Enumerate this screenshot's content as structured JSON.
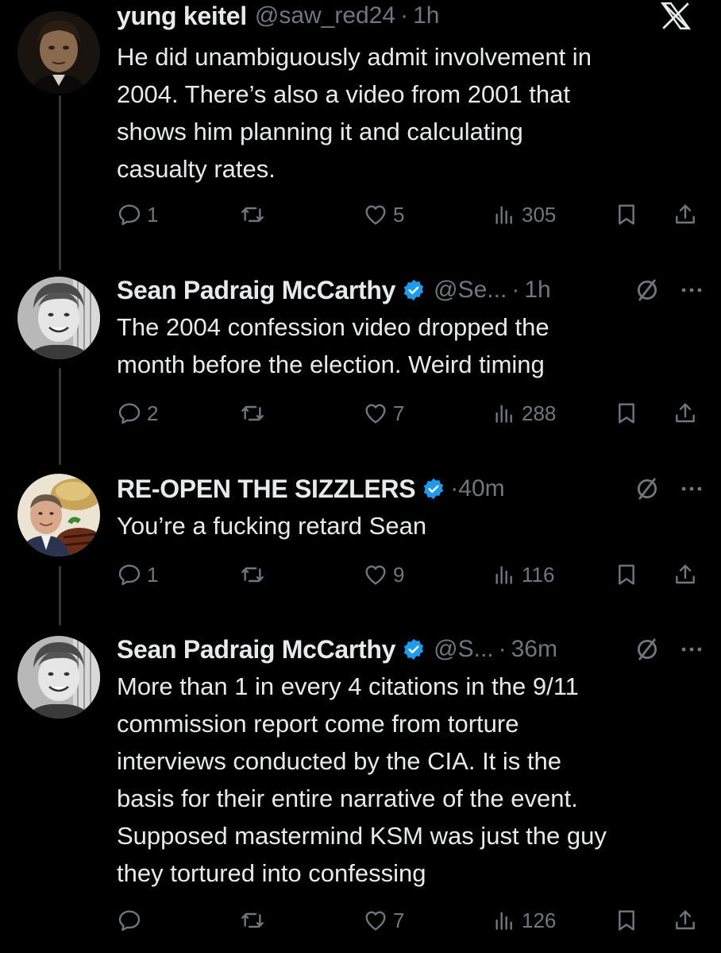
{
  "colors": {
    "background": "#000000",
    "primary_text": "#e7e9ea",
    "secondary_text": "#71767b",
    "verified_blue": "#1d9bf0",
    "thread_line": "#333639"
  },
  "brand": {
    "logo": "x-logo-icon"
  },
  "tweets": [
    {
      "author": {
        "name": "yung keitel",
        "handle": "@saw_red24",
        "verified": false,
        "avatar": "avatar-dark-portrait"
      },
      "time": "1h",
      "text": "He did unambiguously admit involvement in\n2004. There’s also a video from 2001 that\nshows him planning it and calculating\ncasualty rates.",
      "stats": {
        "replies": "1",
        "retweets": "",
        "likes": "5",
        "views": "305"
      },
      "header_icons": [
        "x-logo-icon"
      ]
    },
    {
      "author": {
        "name": "Sean Padraig McCarthy",
        "handle": "@Se...",
        "verified": true,
        "avatar": "avatar-bw-smiling-man"
      },
      "time": "1h",
      "text": "The 2004 confession video dropped the\nmonth before the election. Weird timing",
      "stats": {
        "replies": "2",
        "retweets": "",
        "likes": "7",
        "views": "288"
      },
      "header_icons": [
        "mute-icon",
        "more-icon"
      ]
    },
    {
      "author": {
        "name": "RE-OPEN THE SIZZLERS",
        "handle": "",
        "verified": true,
        "avatar": "avatar-sizzler-steak"
      },
      "time": "40m",
      "text": "You’re a fucking retard Sean",
      "stats": {
        "replies": "1",
        "retweets": "",
        "likes": "9",
        "views": "116"
      },
      "header_icons": [
        "mute-icon",
        "more-icon"
      ]
    },
    {
      "author": {
        "name": "Sean Padraig McCarthy",
        "handle": "@S...",
        "verified": true,
        "avatar": "avatar-bw-smiling-man"
      },
      "time": "36m",
      "text": "More than 1 in every 4 citations in the 9/11\ncommission report come from torture\ninterviews conducted by the CIA. It is the\nbasis for their entire narrative of the event.\nSupposed mastermind KSM was just the guy\nthey tortured into confessing",
      "stats": {
        "replies": "",
        "retweets": "",
        "likes": "7",
        "views": "126"
      },
      "header_icons": [
        "mute-icon",
        "more-icon"
      ]
    }
  ],
  "separator": "·"
}
